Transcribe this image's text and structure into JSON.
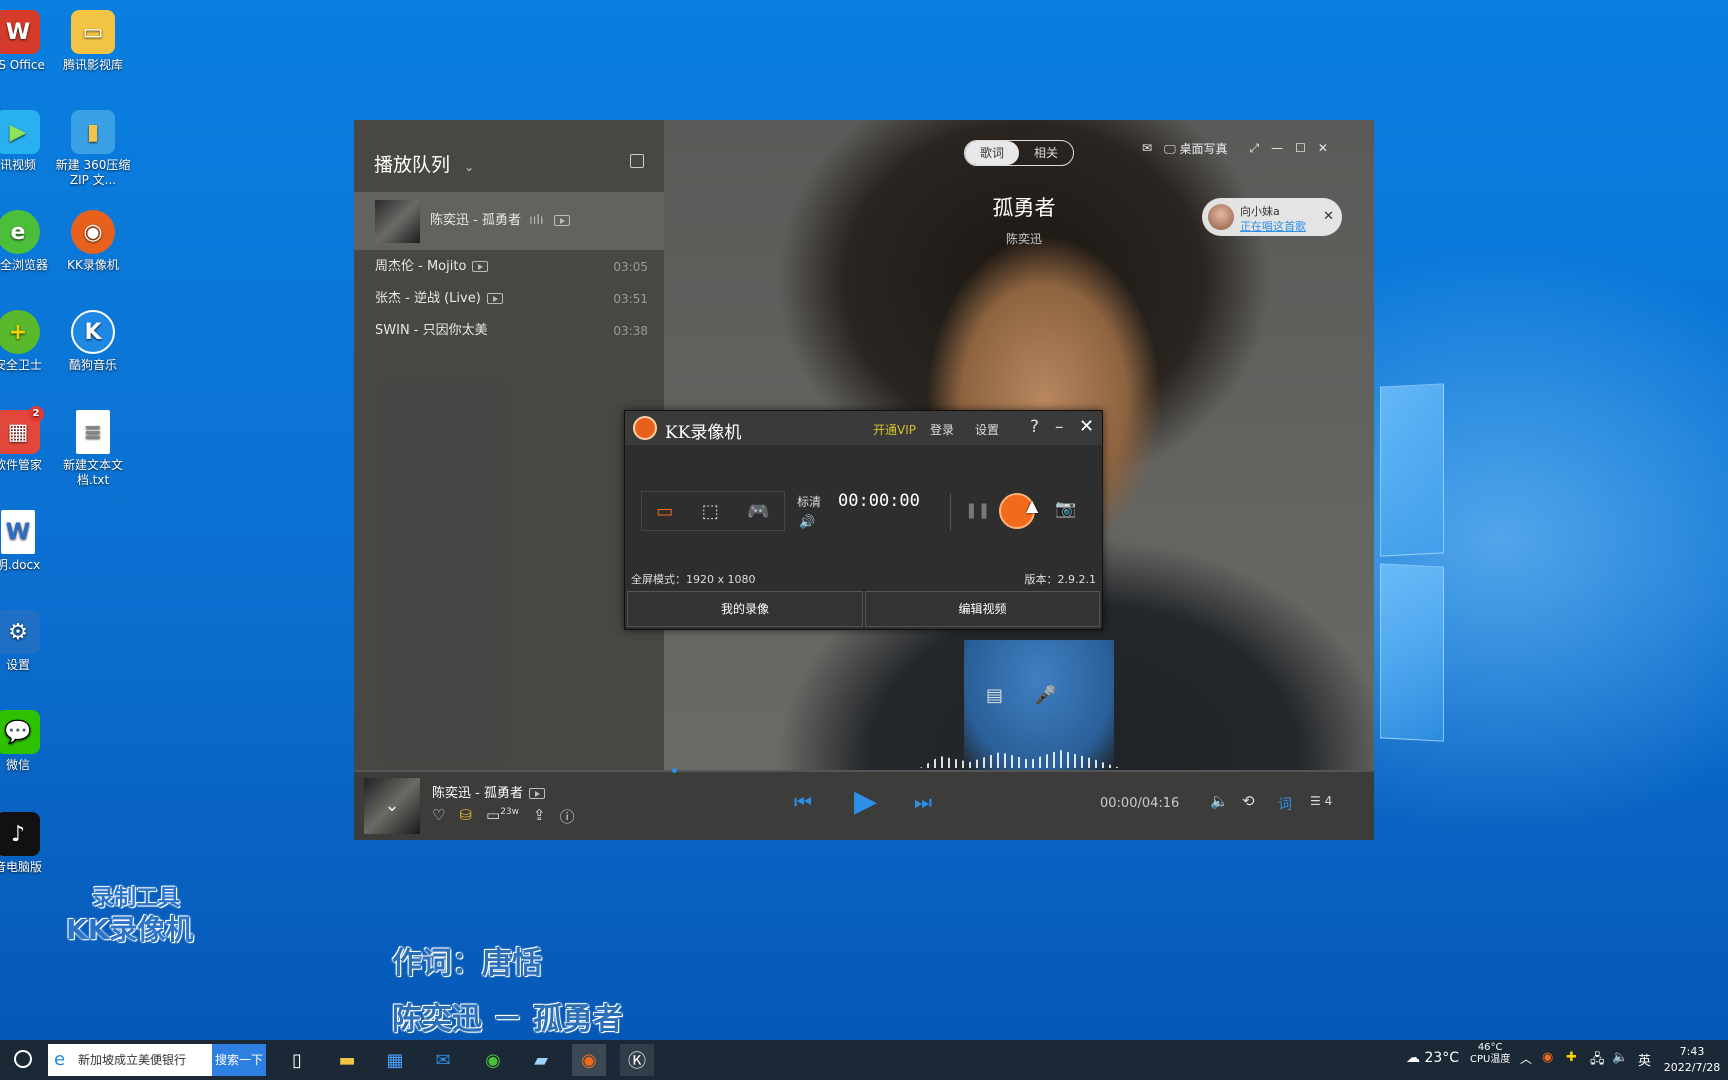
{
  "desktop": {
    "icons": [
      {
        "label": "PS Office",
        "icon": "wps-icon"
      },
      {
        "label": "腾讯影视库",
        "icon": "folder-icon"
      },
      {
        "label": "讯视频",
        "icon": "video-icon"
      },
      {
        "label": "新建 360压缩 ZIP 文...",
        "icon": "zip-icon"
      },
      {
        "label": "安全浏览器",
        "icon": "browser-icon"
      },
      {
        "label": "KK录像机",
        "icon": "kk-recorder-icon"
      },
      {
        "label": "安全卫士",
        "icon": "security-icon"
      },
      {
        "label": "酷狗音乐",
        "icon": "kugou-icon"
      },
      {
        "label": "软件管家",
        "icon": "software-manager-icon"
      },
      {
        "label": "新建文本文档.txt",
        "icon": "text-file-icon"
      },
      {
        "label": "明.docx",
        "icon": "word-file-icon"
      },
      {
        "label": "设置",
        "icon": "settings-icon"
      },
      {
        "label": "微信",
        "icon": "wechat-icon"
      },
      {
        "label": "音电脑版",
        "icon": "douyin-icon"
      }
    ],
    "badge_count": "2",
    "watermark_line1": "录制工具",
    "watermark_line2": "KK录像机",
    "lyric_line1": "作词：唐恬",
    "lyric_line2": "陈奕迅 － 孤勇者"
  },
  "music": {
    "queue_title": "播放队列",
    "queue": [
      {
        "title": "陈奕迅 - 孤勇者",
        "duration": ""
      },
      {
        "title": "周杰伦 - Mojito",
        "duration": "03:05"
      },
      {
        "title": "张杰 - 逆战 (Live)",
        "duration": "03:51"
      },
      {
        "title": "SWIN - 只因你太美",
        "duration": "03:38"
      }
    ],
    "tab_lyrics": "歌词",
    "tab_related": "相关",
    "desktop_mode": "桌面写真",
    "song_title": "孤勇者",
    "artist": "陈奕迅",
    "friend_name": "向小妹a",
    "friend_status": "正在唱这首歌",
    "now_playing": "陈奕迅 - 孤勇者",
    "comment_count": "23w",
    "time": "00:00/04:16",
    "lyrics_btn": "词",
    "queue_count": "4"
  },
  "kk": {
    "title": "KK录像机",
    "vip": "开通VIP",
    "login": "登录",
    "settings": "设置",
    "quality": "标清",
    "timer": "00:00:00",
    "mode_label": "全屏模式：1920 x 1080",
    "version": "版本：2.9.2.1",
    "my_recordings": "我的录像",
    "edit_video": "编辑视频"
  },
  "taskbar": {
    "search_text": "新加坡成立美便银行",
    "search_button": "搜索一下",
    "weather": "23°C",
    "cpu_temp": "46°C",
    "cpu_label": "CPU温度",
    "ime": "英",
    "time": "7:43",
    "date": "2022/7/28"
  },
  "colors": {
    "accent_orange": "#f26a1b",
    "player_blue": "#2d8fe6",
    "vip_yellow": "#d6c12a"
  }
}
